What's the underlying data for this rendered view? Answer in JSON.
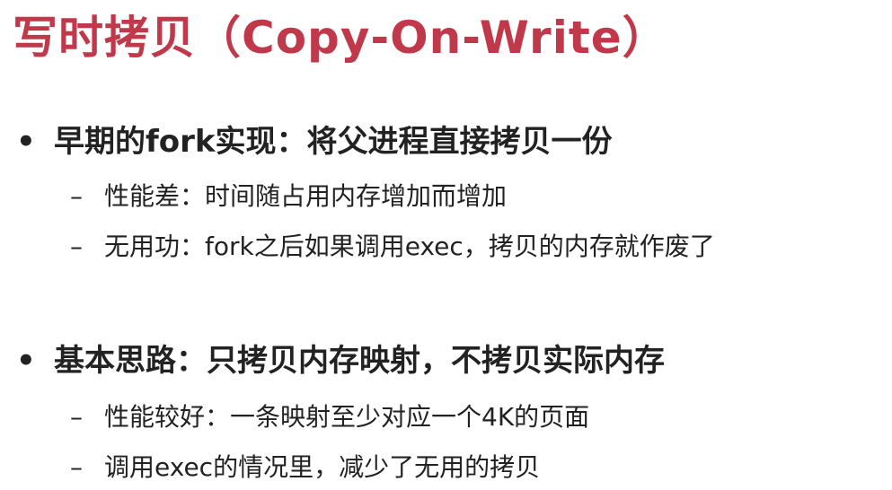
{
  "title": "写时拷贝（Copy-On-Write）",
  "sections": [
    {
      "bullet_marker": "•",
      "heading": "早期的fork实现：将父进程直接拷贝一份",
      "points": [
        {
          "marker": "–",
          "text": "性能差：时间随占用内存增加而增加"
        },
        {
          "marker": "–",
          "text": "无用功：fork之后如果调用exec，拷贝的内存就作废了"
        }
      ]
    },
    {
      "bullet_marker": "•",
      "heading": "基本思路：只拷贝内存映射，不拷贝实际内存",
      "points": [
        {
          "marker": "–",
          "text": "性能较好：一条映射至少对应一个4K的页面"
        },
        {
          "marker": "–",
          "text": "调用exec的情况里，减少了无用的拷贝"
        }
      ]
    }
  ],
  "colors": {
    "title": "#c0394b",
    "body_text": "#222222",
    "background": "#ffffff"
  }
}
